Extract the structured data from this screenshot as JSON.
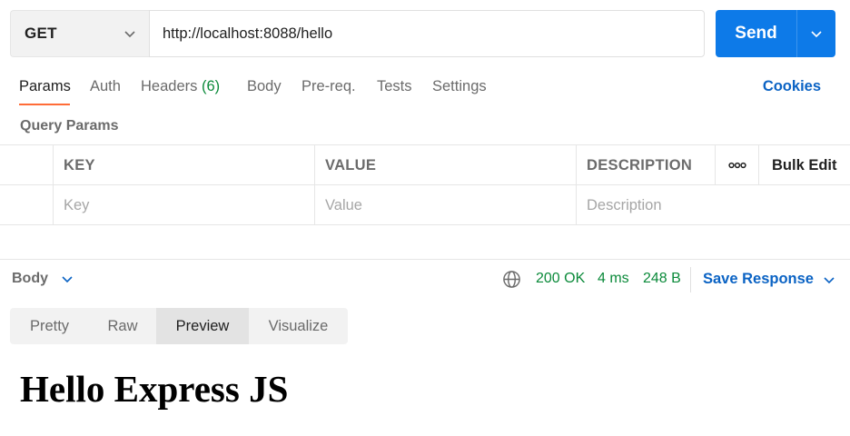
{
  "request": {
    "method": "GET",
    "url": "http://localhost:8088/hello",
    "send_label": "Send"
  },
  "tabs": [
    {
      "label": "Params"
    },
    {
      "label": "Auth"
    },
    {
      "label": "Headers",
      "count": "(6)"
    },
    {
      "label": "Body"
    },
    {
      "label": "Pre-req."
    },
    {
      "label": "Tests"
    },
    {
      "label": "Settings"
    }
  ],
  "active_tab": "Params",
  "cookies_label": "Cookies",
  "query_params": {
    "title": "Query Params",
    "columns": [
      "KEY",
      "VALUE",
      "DESCRIPTION"
    ],
    "more_icon": "ooo",
    "bulk_edit_label": "Bulk Edit",
    "placeholders": {
      "key": "Key",
      "value": "Value",
      "description": "Description"
    }
  },
  "response": {
    "body_label": "Body",
    "status": "200 OK",
    "time": "4 ms",
    "size": "248 B",
    "save_label": "Save Response",
    "views": [
      "Pretty",
      "Raw",
      "Preview",
      "Visualize"
    ],
    "active_view": "Preview",
    "preview_heading": "Hello Express JS"
  },
  "colors": {
    "accent": "#0d7ae8",
    "link": "#0b63c4",
    "success": "#0b8a3a",
    "tab_indicator": "#ff6c37"
  },
  "icons": [
    "chevron-down-icon",
    "globe-icon",
    "more-horizontal-icon"
  ]
}
